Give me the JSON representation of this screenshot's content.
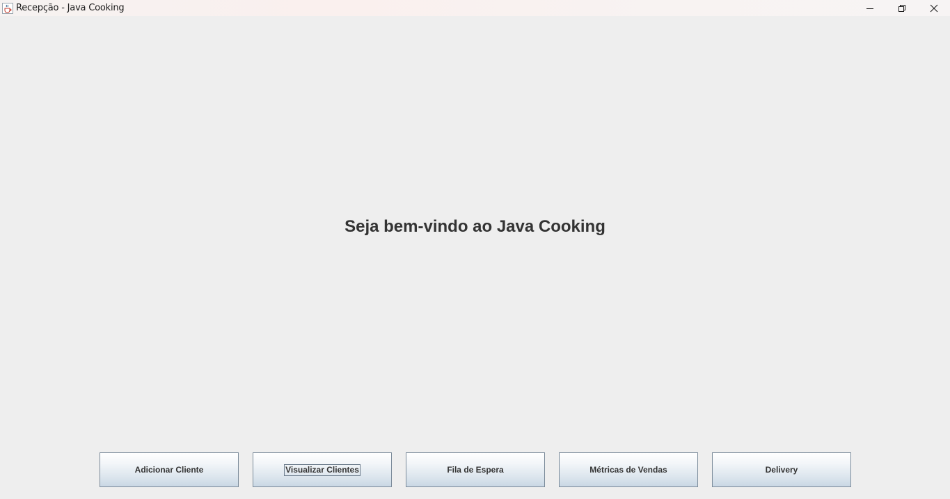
{
  "window": {
    "title": "Recepção - Java Cooking",
    "app_icon": "java-coffee-cup-icon",
    "controls": [
      "minimize-icon",
      "restore-icon",
      "close-icon"
    ]
  },
  "main": {
    "welcome_text": "Seja bem-vindo ao Java Cooking"
  },
  "buttons": {
    "add_client": "Adicionar Cliente",
    "view_clients": "Visualizar Clientes",
    "waiting_queue": "Fila de Espera",
    "sales_metrics": "Métricas de Vendas",
    "delivery": "Delivery"
  },
  "focused_button": "view_clients",
  "colors": {
    "background": "#eeeeee",
    "text": "#333333",
    "button_border": "#7a8a99"
  }
}
